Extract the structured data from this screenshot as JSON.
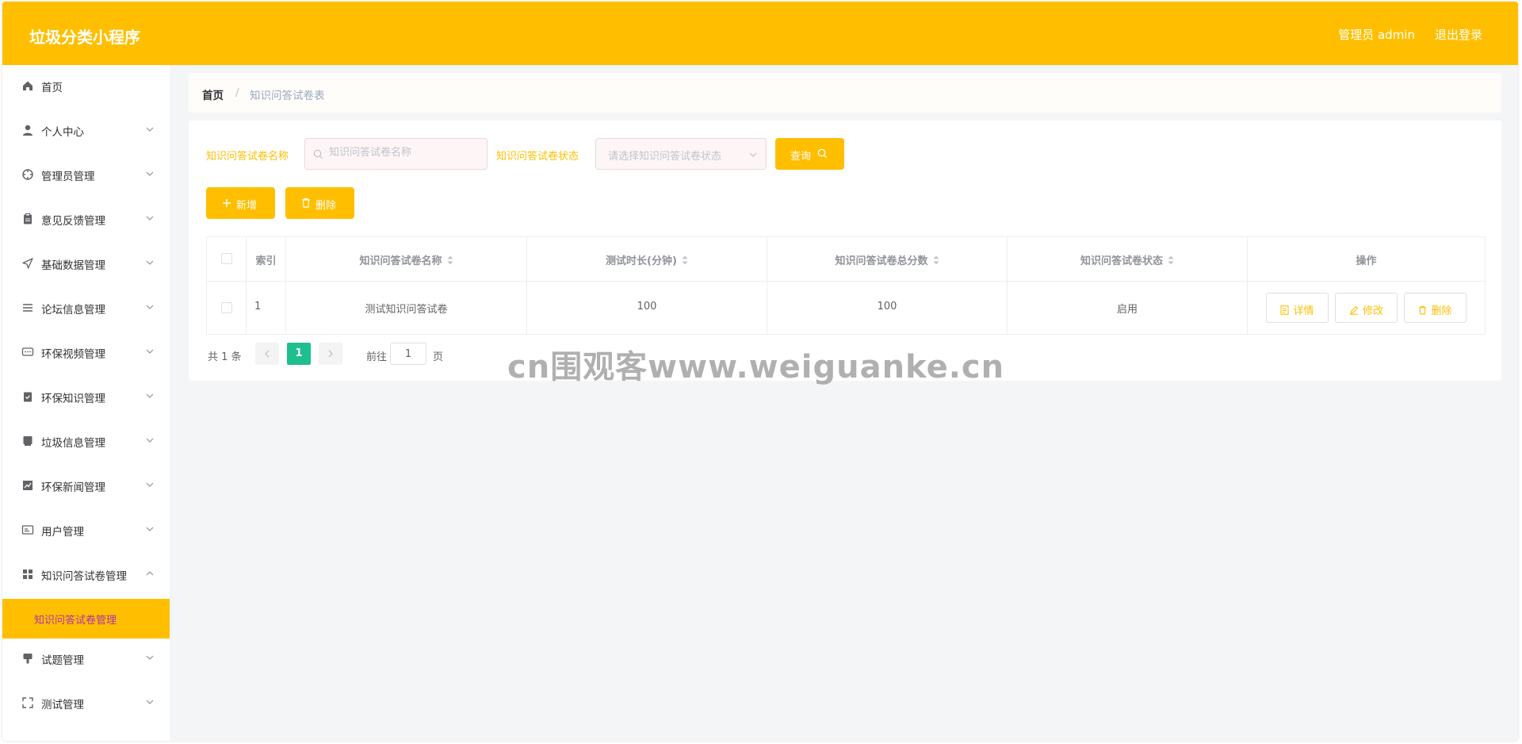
{
  "header": {
    "title": "垃圾分类小程序",
    "user": "管理员 admin",
    "logout": "退出登录"
  },
  "sidebar": {
    "items": [
      {
        "label": "首页",
        "icon": "home-icon"
      },
      {
        "label": "个人中心",
        "icon": "user-icon"
      },
      {
        "label": "管理员管理",
        "icon": "compass-icon"
      },
      {
        "label": "意见反馈管理",
        "icon": "clipboard-icon"
      },
      {
        "label": "基础数据管理",
        "icon": "send-icon"
      },
      {
        "label": "论坛信息管理",
        "icon": "list-icon"
      },
      {
        "label": "环保视频管理",
        "icon": "chat-icon"
      },
      {
        "label": "环保知识管理",
        "icon": "checklist-icon"
      },
      {
        "label": "垃圾信息管理",
        "icon": "box-icon"
      },
      {
        "label": "环保新闻管理",
        "icon": "chart-icon"
      },
      {
        "label": "用户管理",
        "icon": "id-card-icon"
      },
      {
        "label": "知识问答试卷管理",
        "icon": "grid-icon"
      },
      {
        "label": "试题管理",
        "icon": "brush-icon"
      },
      {
        "label": "测试管理",
        "icon": "fullscreen-icon"
      }
    ],
    "active_sub": "知识问答试卷管理"
  },
  "breadcrumb": {
    "home": "首页",
    "separator": "/",
    "current": "知识问答试卷表"
  },
  "search": {
    "name_label": "知识问答试卷名称",
    "name_placeholder": "知识问答试卷名称",
    "status_label": "知识问答试卷状态",
    "status_placeholder": "请选择知识问答试卷状态",
    "query_button": "查询"
  },
  "actions": {
    "add": "新增",
    "delete": "删除"
  },
  "table": {
    "columns": [
      "索引",
      "知识问答试卷名称",
      "测试时长(分钟)",
      "知识问答试卷总分数",
      "知识问答试卷状态",
      "操作"
    ],
    "rows": [
      {
        "index": "1",
        "name": "测试知识问答试卷",
        "duration": "100",
        "score": "100",
        "status": "启用"
      }
    ],
    "row_actions": [
      "详情",
      "修改",
      "删除"
    ]
  },
  "pagination": {
    "total": "共 1 条",
    "current_page": "1",
    "goto_label": "前往",
    "goto_value": "1",
    "page_suffix": "页"
  },
  "watermark": "cn围观客www.weiguanke.cn",
  "colors": {
    "brand": "#ffbf00",
    "active_page": "#1dbf8e",
    "active_sub_text": "#b230a8"
  }
}
